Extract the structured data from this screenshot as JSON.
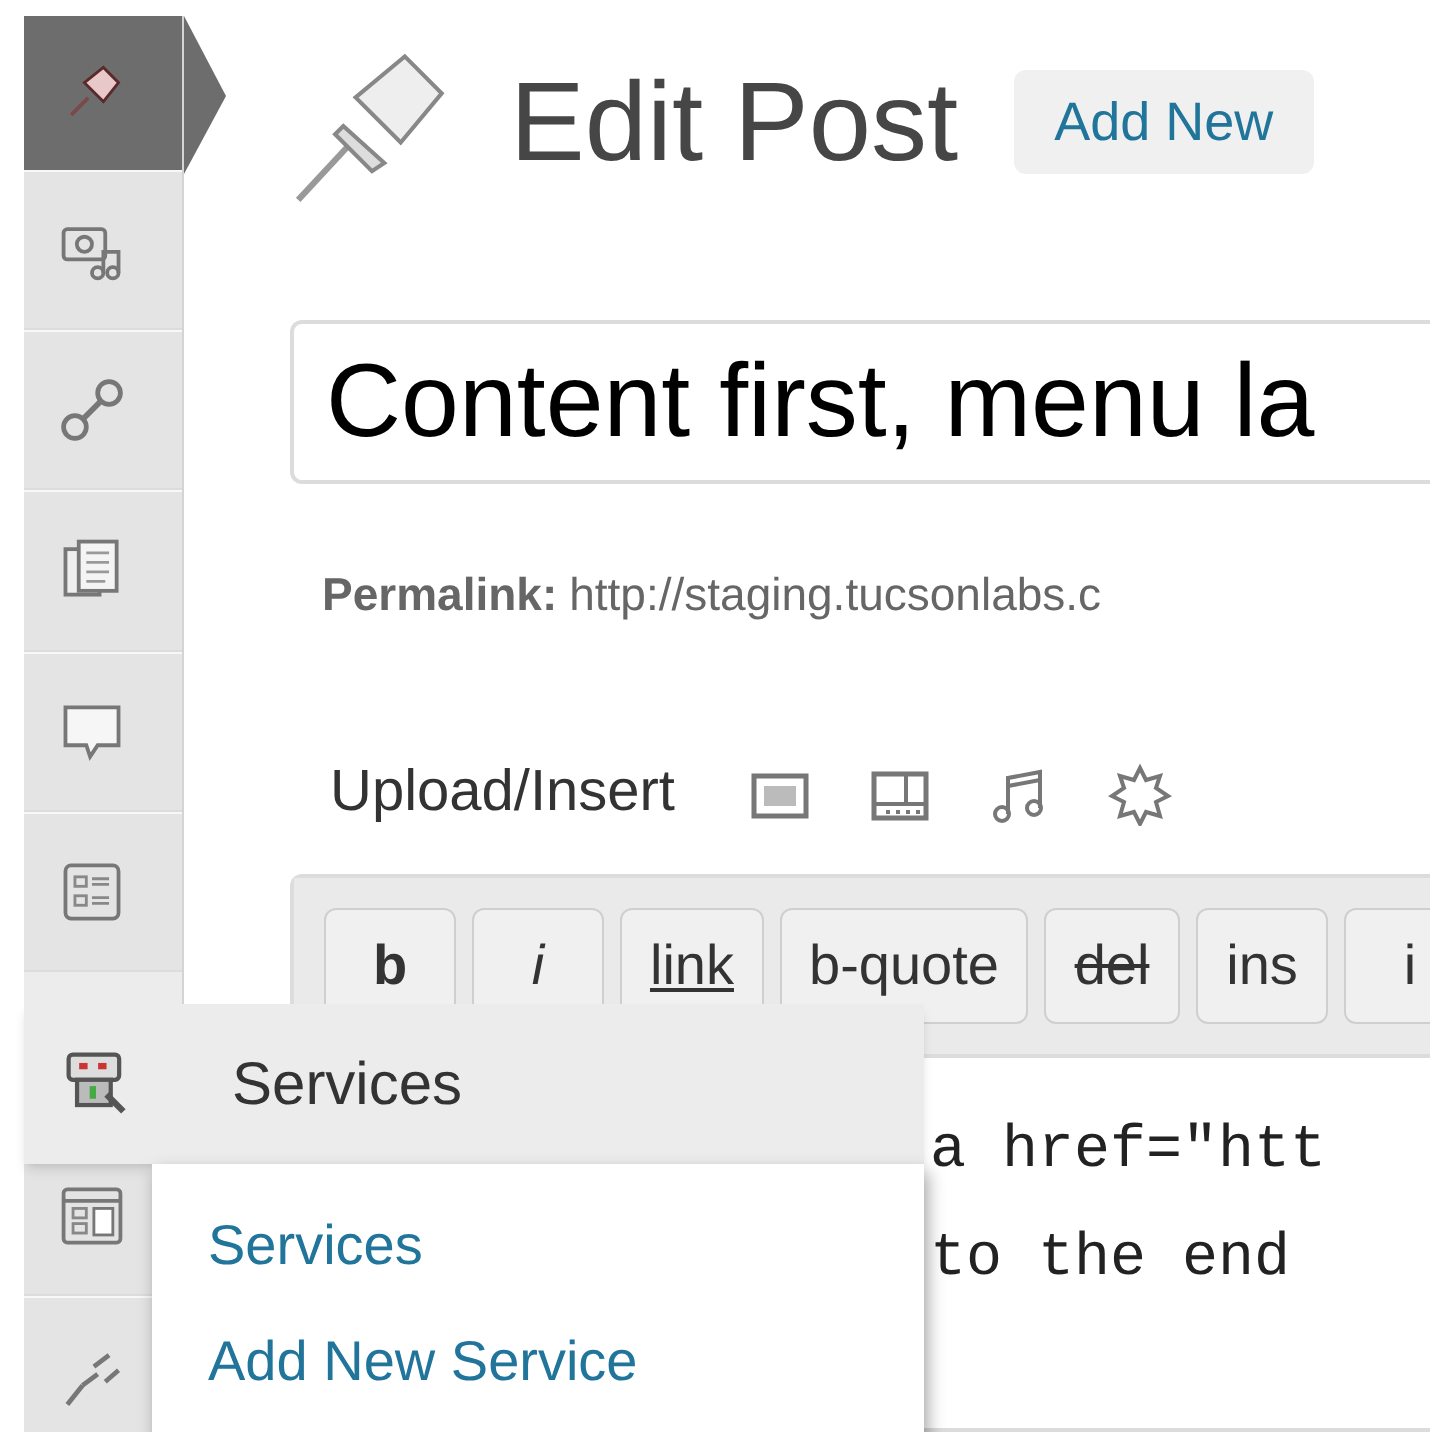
{
  "sidebar": {
    "items": [
      {
        "kind": "posts",
        "selected": true,
        "hovered": false
      },
      {
        "kind": "media",
        "selected": false,
        "hovered": false
      },
      {
        "kind": "links",
        "selected": false,
        "hovered": false
      },
      {
        "kind": "pages",
        "selected": false,
        "hovered": false
      },
      {
        "kind": "comments",
        "selected": false,
        "hovered": false
      },
      {
        "kind": "forms",
        "selected": false,
        "hovered": false
      },
      {
        "kind": "services",
        "selected": false,
        "hovered": true
      },
      {
        "kind": "appearance",
        "selected": false,
        "hovered": false
      },
      {
        "kind": "plugins",
        "selected": false,
        "hovered": false
      }
    ]
  },
  "flyout": {
    "title": "Services",
    "items": [
      "Services",
      "Add New Service"
    ]
  },
  "page_header": {
    "title": "Edit Post",
    "add_new": "Add New"
  },
  "post_title": {
    "value": "Content first, menu la"
  },
  "permalink": {
    "label": "Permalink:",
    "url": "http://staging.tucsonlabs.c"
  },
  "upload_insert": {
    "label": "Upload/Insert",
    "buttons": [
      {
        "kind": "image"
      },
      {
        "kind": "video"
      },
      {
        "kind": "audio"
      },
      {
        "kind": "media"
      }
    ]
  },
  "quicktags": [
    {
      "label": "b",
      "kind": "bold"
    },
    {
      "label": "i",
      "kind": "italic"
    },
    {
      "label": "link",
      "kind": "link"
    },
    {
      "label": "b-quote",
      "kind": "plain"
    },
    {
      "label": "del",
      "kind": "del"
    },
    {
      "label": "ins",
      "kind": "plain"
    },
    {
      "label": "i",
      "kind": "plain"
    }
  ],
  "editor_lines": [
    "a href=\"htt",
    "to the end"
  ]
}
